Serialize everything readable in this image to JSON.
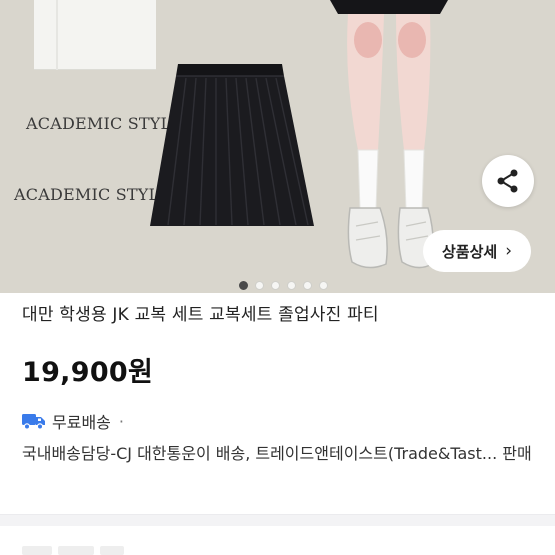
{
  "gallery": {
    "caption_1": "ACADEMIC STYLE",
    "caption_2": "ACADEMIC STYLE",
    "share_icon": "share-icon",
    "detail_button_label": "상품상세",
    "detail_button_chevron": "›",
    "slide_count": 6,
    "active_slide": 1
  },
  "product": {
    "title": "대만 학생용 JK 교복 세트 교복세트 졸업사진 파티",
    "price": "19,900원"
  },
  "shipping": {
    "icon": "delivery-truck-icon",
    "free_label": "무료배송",
    "separator": "·",
    "accent_color": "#3a7bea",
    "description": "국내배송담당-CJ 대한통운이 배송, 트레이드앤테이스트(Trade&Tast... 판매"
  }
}
